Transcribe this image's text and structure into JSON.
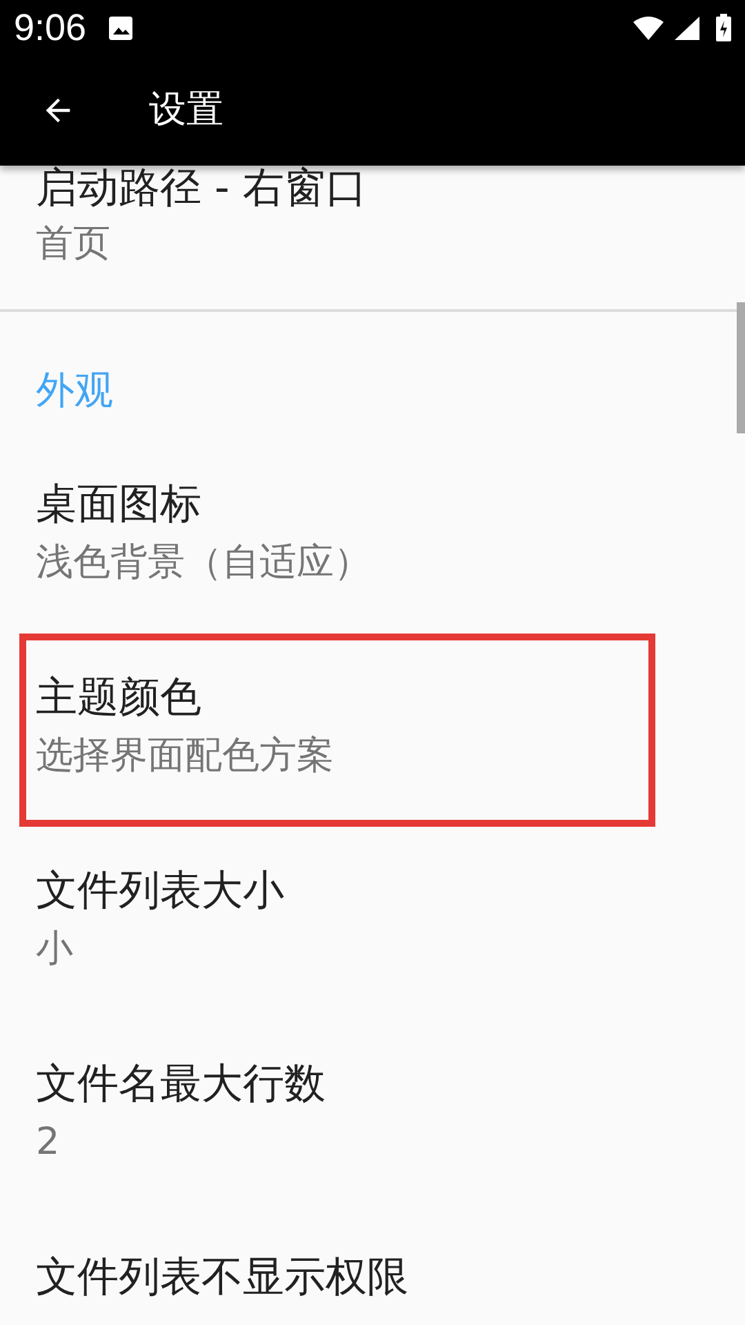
{
  "status_bar": {
    "time": "9:06"
  },
  "toolbar": {
    "title": "设置"
  },
  "top_item": {
    "title": "启动路径 - 右窗口",
    "summary": "首页"
  },
  "category": {
    "title": "外观"
  },
  "items": [
    {
      "title": "桌面图标",
      "summary": "浅色背景（自适应）",
      "highlighted": false
    },
    {
      "title": "主题颜色",
      "summary": "选择界面配色方案",
      "highlighted": true
    },
    {
      "title": "文件列表大小",
      "summary": "小",
      "highlighted": false
    },
    {
      "title": "文件名最大行数",
      "summary": "2",
      "highlighted": false
    },
    {
      "title": "文件列表不显示权限",
      "highlighted": false
    }
  ]
}
